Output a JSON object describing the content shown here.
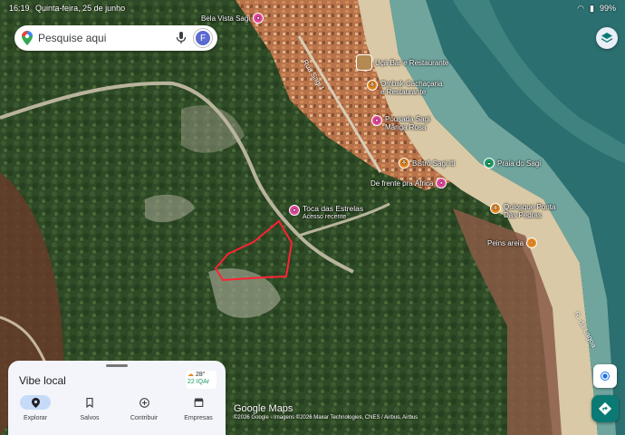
{
  "status_bar": {
    "time": "16:19",
    "date": "Quinta-feira, 25 de junho",
    "battery": "99%"
  },
  "search": {
    "placeholder": "Pesquise aqui",
    "avatar_initial": "F"
  },
  "pois": [
    {
      "label": "Bela Vista Sagi",
      "color": "pink",
      "icon": "hotel-icon"
    },
    {
      "label": "Uçá Bar e Restaurante",
      "color": "photo",
      "icon": "photo-thumbnail"
    },
    {
      "label": "Ombak Cachaçaria\ne Restaurante",
      "color": "orange",
      "icon": "restaurant-icon"
    },
    {
      "label": "Pousada Sagi\nManga Rosa",
      "color": "pink",
      "icon": "hotel-icon"
    },
    {
      "label": "Bistrô Sagi Iti",
      "color": "orange",
      "icon": "restaurant-icon"
    },
    {
      "label": "Praia do Sagi",
      "color": "green",
      "icon": "beach-icon"
    },
    {
      "label": "De frente pra África",
      "color": "pink",
      "icon": "hotel-icon"
    },
    {
      "label": "Toca das Estrelas",
      "sublabel": "Acesso recente",
      "color": "pink",
      "icon": "hotel-icon"
    },
    {
      "label": "Quiosque Ponta\nDas Pedras",
      "color": "orange",
      "icon": "restaurant-icon"
    },
    {
      "label": "Peins areia",
      "color": "orange",
      "icon": "shop-icon"
    }
  ],
  "roads": [
    "Rua Sagi I",
    "R. da Lagoa"
  ],
  "sheet": {
    "title": "Vibe local",
    "weather_temp": "28°",
    "weather_sub": "22 IQAr",
    "tabs": [
      {
        "label": "Explorar",
        "icon": "explore-icon",
        "active": true
      },
      {
        "label": "Salvos",
        "icon": "bookmark-icon",
        "active": false
      },
      {
        "label": "Contribuir",
        "icon": "add-icon",
        "active": false
      },
      {
        "label": "Empresas",
        "icon": "store-icon",
        "active": false
      }
    ]
  },
  "branding": "Google Maps",
  "attribution": "©2026 Google · Imagens ©2026 Maxar Technologies, CNES / Airbus, Airbus",
  "colors": {
    "outline": "#ff2233",
    "accent": "#0b7a74"
  }
}
